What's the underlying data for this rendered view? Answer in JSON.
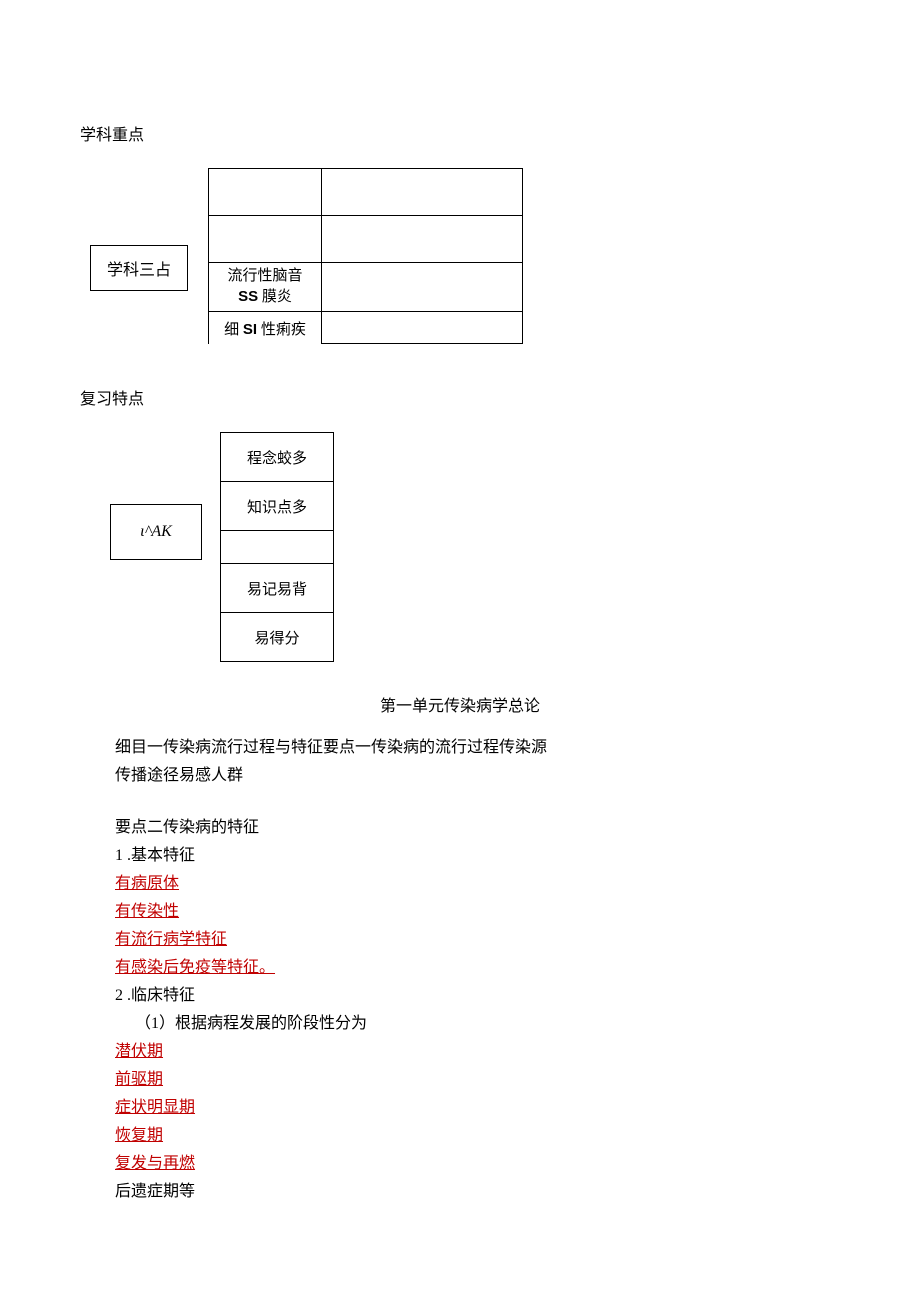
{
  "section1_title": "学科重点",
  "table1": {
    "left_label": "学科三占",
    "rows": [
      {
        "c1": "",
        "c2": ""
      },
      {
        "c1": "",
        "c2": ""
      },
      {
        "c1_a": "流行性脑音",
        "c1_b": "SS 膜炎",
        "c2": ""
      },
      {
        "c1_a": "细 SI 性痢疾",
        "c2": ""
      }
    ]
  },
  "section2_title": "复习特点",
  "table2": {
    "left_label": "ι^AK",
    "cells": [
      "程念蛟多",
      "知识点多",
      "",
      "易记易背",
      "易得分"
    ]
  },
  "unit_title": "第一单元传染病学总论",
  "para1_l1": "细目一传染病流行过程与特征要点一传染病的流行过程传染源",
  "para1_l2": "传播途径易感人群",
  "sec2_heading": "要点二传染病的特征",
  "item1": "1 .基本特征",
  "red1": "有病原体",
  "red2": "有传染性",
  "red3": "有流行病学特征",
  "red4": "有感染后免疫等特征。",
  "item2": "2 .临床特征",
  "item2_sub": "（1）根据病程发展的阶段性分为",
  "red5": "潜伏期",
  "red6": "前驱期",
  "red7": "症状明显期",
  "red8": "恢复期",
  "red9": "复发与再燃",
  "tail": "后遗症期等"
}
